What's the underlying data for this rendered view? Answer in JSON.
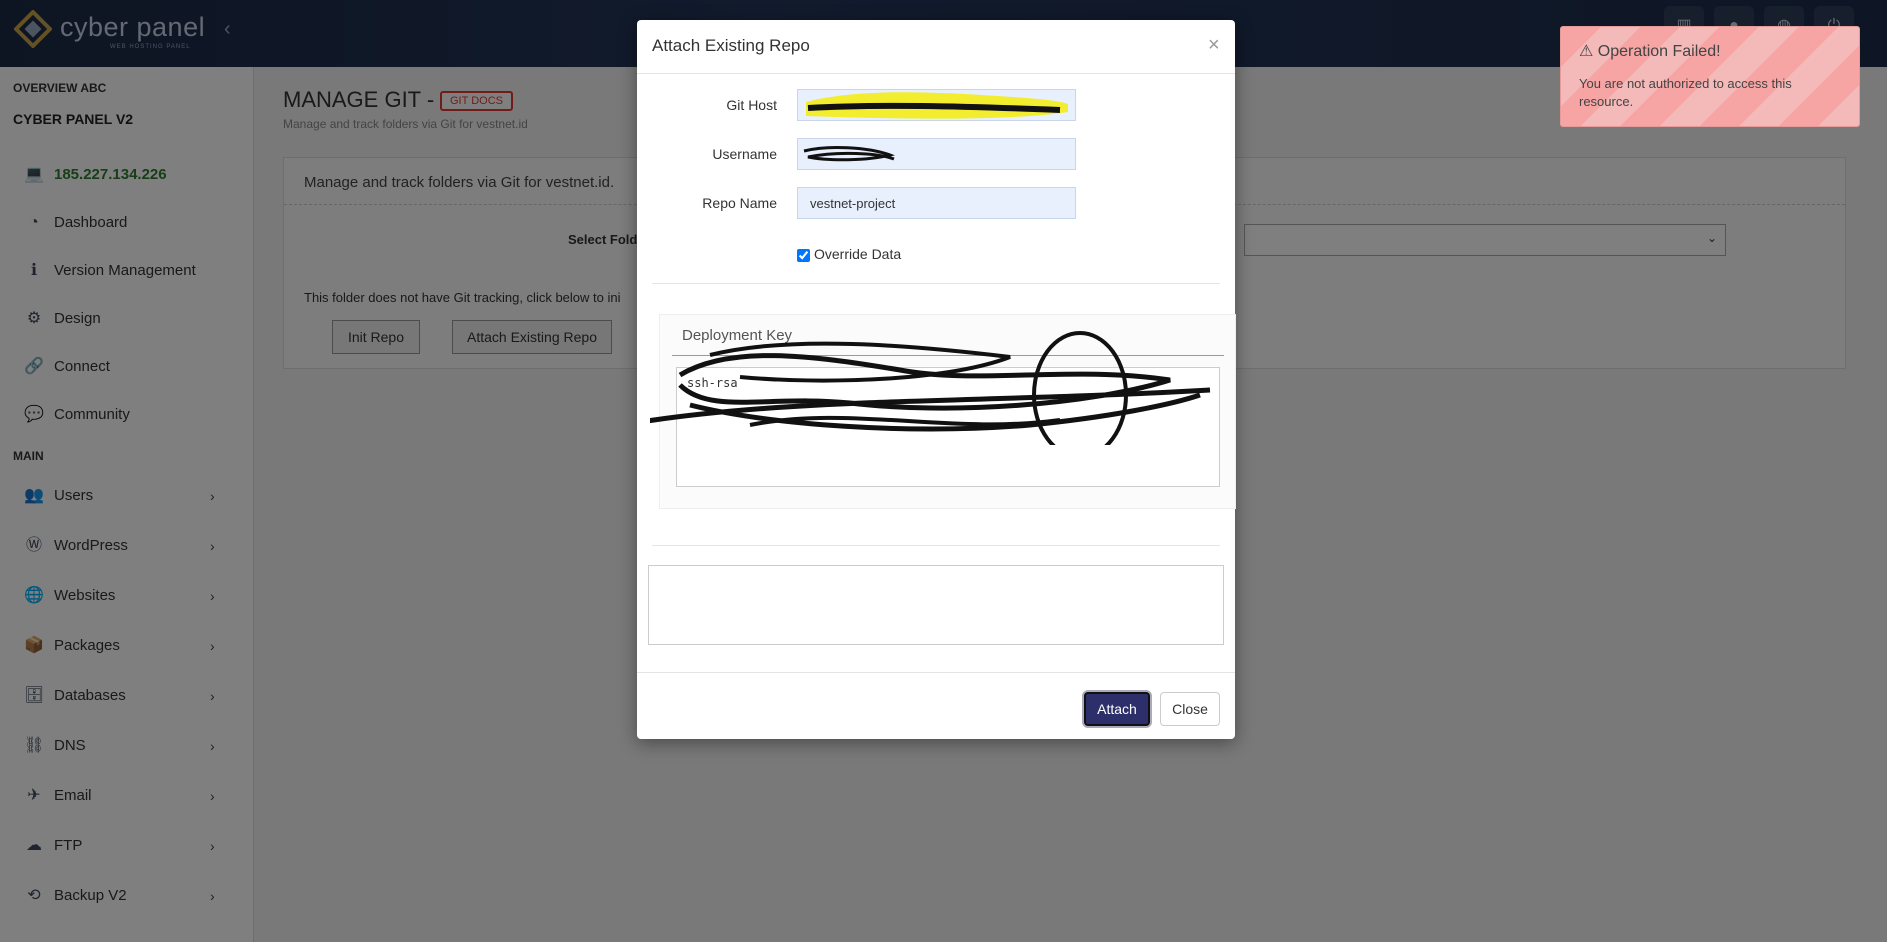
{
  "app": {
    "logo_text": "cyber panel",
    "logo_sub": "WEB HOSTING PANEL"
  },
  "sidebar": {
    "overview": "OVERVIEW ABC",
    "title": "CYBER PANEL V2",
    "ip": "185.227.134.226",
    "main_heading": "MAIN",
    "items_top": [
      {
        "label": "Dashboard",
        "icon": "dashboard-icon"
      },
      {
        "label": "Version Management",
        "icon": "info-icon"
      },
      {
        "label": "Design",
        "icon": "gear-icon"
      },
      {
        "label": "Connect",
        "icon": "link-icon"
      },
      {
        "label": "Community",
        "icon": "chat-icon"
      }
    ],
    "items_main": [
      {
        "label": "Users",
        "icon": "users-icon"
      },
      {
        "label": "WordPress",
        "icon": "wordpress-icon"
      },
      {
        "label": "Websites",
        "icon": "globe-icon"
      },
      {
        "label": "Packages",
        "icon": "packages-icon"
      },
      {
        "label": "Databases",
        "icon": "database-icon"
      },
      {
        "label": "DNS",
        "icon": "sitemap-icon"
      },
      {
        "label": "Email",
        "icon": "paper-plane-icon"
      },
      {
        "label": "FTP",
        "icon": "cloud-upload-icon"
      },
      {
        "label": "Backup V2",
        "icon": "backup-icon"
      }
    ]
  },
  "page": {
    "title": "MANAGE GIT -",
    "docs_badge": "GIT DOCS",
    "subtitle": "Manage and track folders via Git for vestnet.id",
    "panel_heading": "Manage and track folders via Git for vestnet.id.",
    "select_label": "Select Folder to",
    "note": "This folder does not have Git tracking, click below to ini",
    "init_button": "Init Repo",
    "attach_button": "Attach Existing Repo"
  },
  "modal": {
    "title": "Attach Existing Repo",
    "git_host_label": "Git Host",
    "username_label": "Username",
    "repo_name_label": "Repo Name",
    "repo_name_value": "vestnet-project",
    "override_label": "Override Data",
    "override_checked": true,
    "deploy_key_title": "Deployment Key",
    "deploy_key_prefix": "ssh-rsa",
    "attach_label": "Attach",
    "close_label": "Close"
  },
  "toast": {
    "title": "Operation Failed!",
    "message": "You are not authorized to access this resource."
  }
}
